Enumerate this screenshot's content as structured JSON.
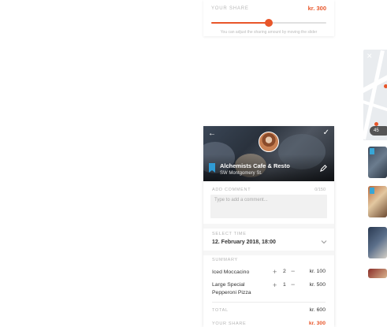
{
  "top_share": {
    "label": "YOUR SHARE",
    "amount": "kr. 300",
    "slider_fraction": 0.5,
    "hint": "You can adjust the sharing amount by moving the slider"
  },
  "map_badge": "45",
  "detail": {
    "venue_name": "Alchemists Cafe & Resto",
    "venue_address": "SW Montgomery St.",
    "comment": {
      "label": "ADD COMMENT",
      "counter": "0/150",
      "placeholder": "Type to add a comment..."
    },
    "time": {
      "label": "SELECT TIME",
      "value": "12. February 2018, 18:00"
    },
    "summary": {
      "label": "SUMMARY",
      "items": [
        {
          "name": "Iced Moccacino",
          "qty": "2",
          "price": "kr. 100"
        },
        {
          "name": "Large Special Pepperoni Pizza",
          "qty": "1",
          "price": "kr. 500"
        }
      ]
    },
    "total_label": "TOTAL",
    "total_value": "kr. 600",
    "share_label": "YOUR SHARE",
    "share_value": "kr. 300"
  },
  "colors": {
    "accent": "#e8562a",
    "bookmark": "#2f9bd5"
  }
}
